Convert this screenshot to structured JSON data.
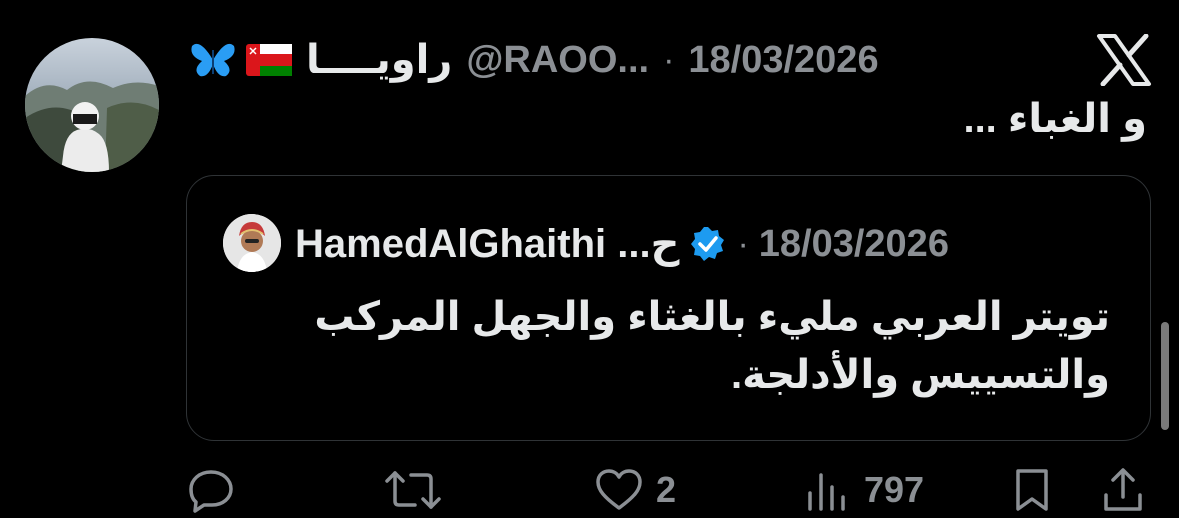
{
  "author": {
    "display_name": "راويــــا",
    "handle": "@RAOO...",
    "separator": "·",
    "date": "18/03/2026"
  },
  "tweet": {
    "text": "و الغباء ..."
  },
  "quoted": {
    "display_name": "HamedAlGhaithi ...ح",
    "separator": "·",
    "date": "18/03/2026",
    "text": "تويتر العربي مليء بالغثاء والجهل المركب والتسييس والأدلجة."
  },
  "stats": {
    "likes": "2",
    "views": "797"
  },
  "icons": {
    "logo": "x-logo-icon",
    "reply": "reply-icon",
    "retweet": "retweet-icon",
    "like": "heart-icon",
    "views": "views-icon",
    "bookmark": "bookmark-icon",
    "share": "share-icon",
    "verified": "verified-badge-icon",
    "flag": "oman-flag-icon",
    "butterfly": "butterfly-icon"
  },
  "colors": {
    "background": "#000000",
    "text": "#e7e9ea",
    "muted": "#8b8f94",
    "border": "#2f3336",
    "verified": "#1d9bf0"
  }
}
